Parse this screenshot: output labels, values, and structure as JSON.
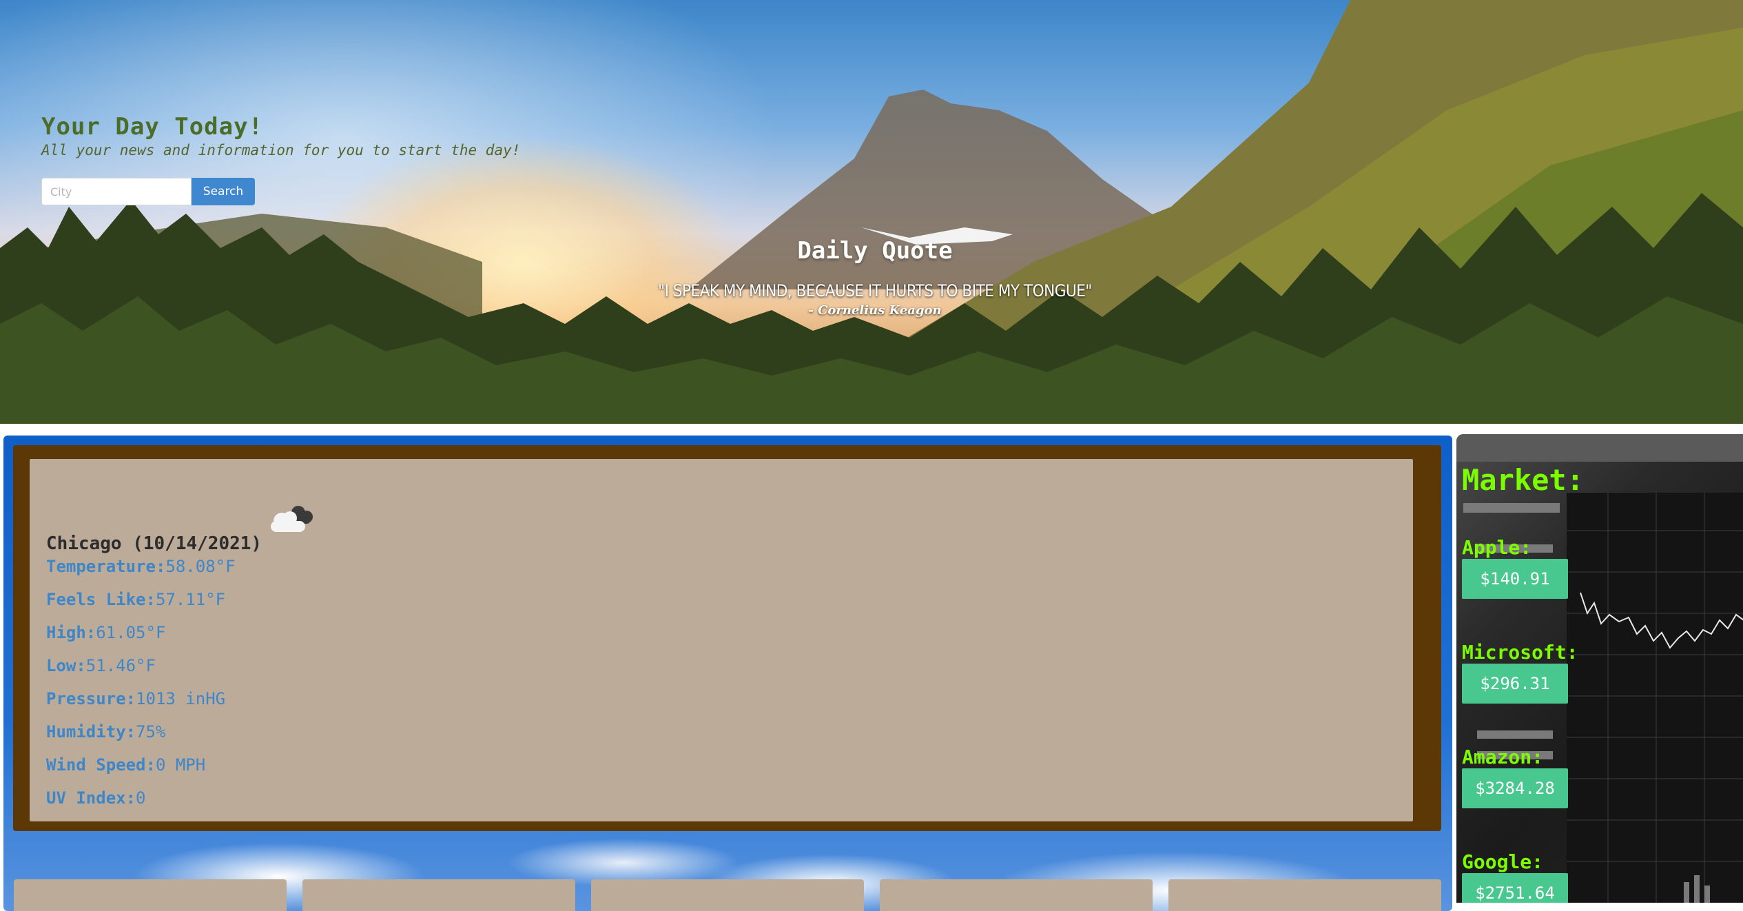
{
  "hero": {
    "title": "Your Day Today!",
    "subtitle": "All your news and information for you to start the day!",
    "search": {
      "placeholder": "City",
      "value": "",
      "button_label": "Search"
    }
  },
  "quote": {
    "title": "Daily Quote",
    "text": "\"I speak my mind, because it hurts to bite my tongue\"",
    "author": "- Cornelius Keagon"
  },
  "weather": {
    "icon": "broken-clouds-icon",
    "city_date": "Chicago (10/14/2021)",
    "rows": [
      {
        "label": "Temperature:",
        "value": "58.08°F"
      },
      {
        "label": "Feels Like:",
        "value": "57.11°F"
      },
      {
        "label": "High:",
        "value": "61.05°F"
      },
      {
        "label": "Low:",
        "value": "51.46°F"
      },
      {
        "label": "Pressure:",
        "value": "1013 inHG"
      },
      {
        "label": "Humidity:",
        "value": "75%"
      },
      {
        "label": "Wind Speed:",
        "value": "0 MPH"
      },
      {
        "label": "UV Index:",
        "value": "0"
      }
    ]
  },
  "market": {
    "title": "Market:",
    "stocks": [
      {
        "name": "Apple:",
        "price": "$140.91"
      },
      {
        "name": "Microsoft:",
        "price": "$296.31"
      },
      {
        "name": "Amazon:",
        "price": "$3284.28"
      },
      {
        "name": "Google:",
        "price": "$2751.64"
      }
    ]
  },
  "colors": {
    "hero_title": "#4c6c2a",
    "search_button": "#3f87cf",
    "weather_frame": "#5c3807",
    "weather_card": "#bcab99",
    "weather_text": "#3f86c9",
    "market_accent": "#7cfc00",
    "price_badge": "#48c78e"
  }
}
